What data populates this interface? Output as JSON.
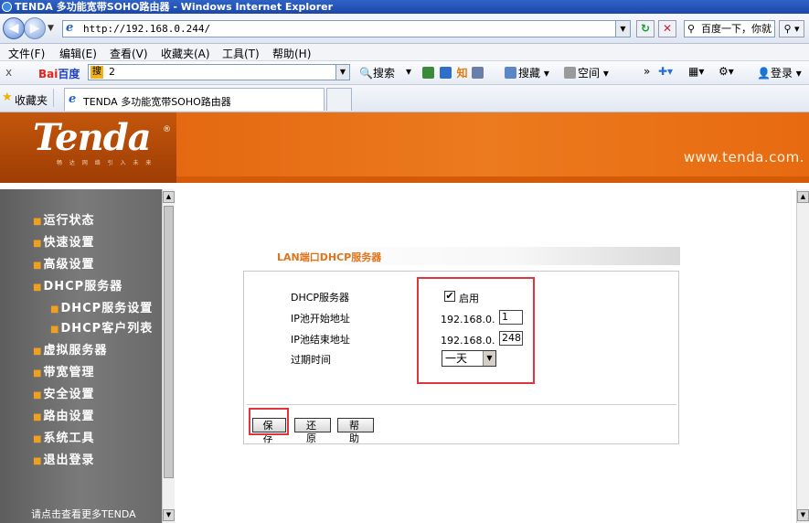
{
  "browser": {
    "window_title": "TENDA 多功能宽带SOHO路由器 - Windows Internet Explorer",
    "address": "http://192.168.0.244/",
    "search_placeholder": "百度一下，你就",
    "back_icon": "back-arrow",
    "forward_icon": "forward-arrow",
    "refresh_icon": "refresh-icon",
    "stop_icon": "stop-icon"
  },
  "menu": [
    "文件(F)",
    "编辑(E)",
    "查看(V)",
    "收藏夹(A)",
    "工具(T)",
    "帮助(H)"
  ],
  "baidu_toolbar": {
    "close": "x",
    "logo_part1": "Bai",
    "logo_part2": "百度",
    "query_tag": "搜",
    "query": "2",
    "search_label": "搜索",
    "know_label": "知",
    "news_label": "搜藏",
    "space_label": "空间",
    "login_label": "登录",
    "more": "»"
  },
  "favorites": {
    "label": "收藏夹",
    "tab_title": "TENDA 多功能宽带SOHO路由器"
  },
  "header": {
    "logo": "Tenda",
    "slogan": "畅 达 网 络 引 入 未 来",
    "website": "www.tenda.com."
  },
  "nav": {
    "items": [
      {
        "label": "运行状态"
      },
      {
        "label": "快速设置"
      },
      {
        "label": "高级设置"
      },
      {
        "label": "DHCP服务器"
      },
      {
        "label": "DHCP服务设置",
        "sub": true
      },
      {
        "label": "DHCP客户列表",
        "sub": true
      },
      {
        "label": "虚拟服务器"
      },
      {
        "label": "带宽管理"
      },
      {
        "label": "安全设置"
      },
      {
        "label": "路由设置"
      },
      {
        "label": "系统工具"
      },
      {
        "label": "退出登录"
      }
    ],
    "more_text": "请点击查看更多TENDA"
  },
  "form": {
    "title": "LAN端口DHCP服务器",
    "dhcp_label": "DHCP服务器",
    "dhcp_enable_label": "启用",
    "dhcp_enabled": true,
    "check_mark": "✔",
    "start_label": "IP池开始地址",
    "end_label": "IP池结束地址",
    "lease_label": "过期时间",
    "ip_prefix": "192.168.0.",
    "start_value": "1",
    "end_value": "248",
    "lease_value": "一天"
  },
  "buttons": {
    "save": "保存",
    "restore": "还原",
    "help": "帮助"
  }
}
